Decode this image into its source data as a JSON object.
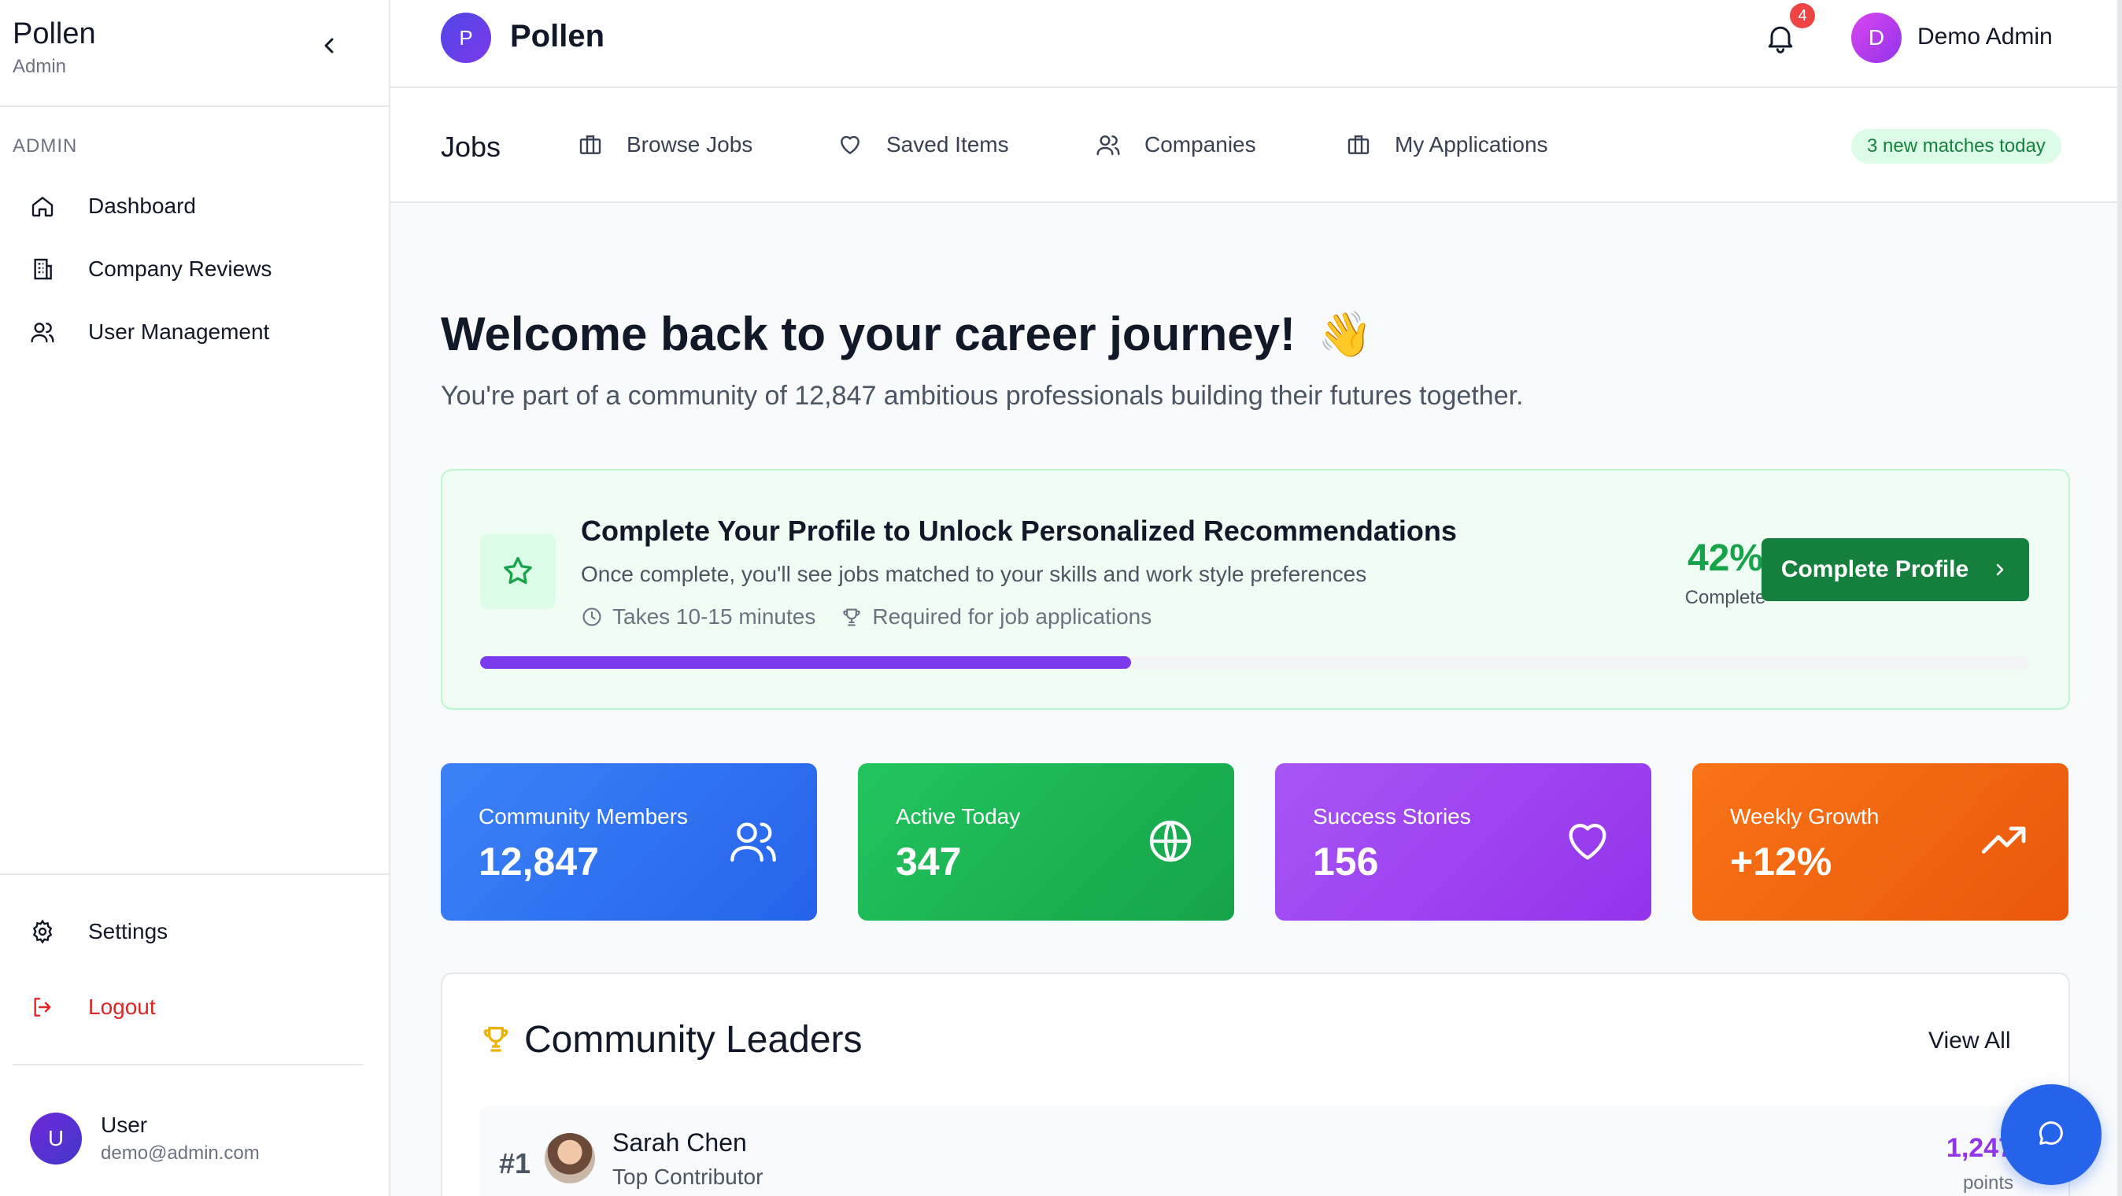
{
  "sidebar": {
    "brand": "Pollen",
    "role": "Admin",
    "section": "ADMIN",
    "items": [
      {
        "label": "Dashboard",
        "icon": "home-icon"
      },
      {
        "label": "Company Reviews",
        "icon": "building-icon"
      },
      {
        "label": "User Management",
        "icon": "users-icon"
      }
    ],
    "settings_label": "Settings",
    "logout_label": "Logout",
    "user": {
      "initial": "U",
      "name": "User",
      "email": "demo@admin.com"
    }
  },
  "header": {
    "logo_initial": "P",
    "logo_text": "Pollen",
    "notification_count": "4",
    "admin_initial": "D",
    "admin_name": "Demo Admin"
  },
  "jobs_nav": {
    "title": "Jobs",
    "links": [
      {
        "label": "Browse Jobs",
        "icon": "briefcase-icon"
      },
      {
        "label": "Saved Items",
        "icon": "heart-icon"
      },
      {
        "label": "Companies",
        "icon": "users-icon"
      },
      {
        "label": "My Applications",
        "icon": "briefcase-icon"
      }
    ],
    "badge": "3 new matches today"
  },
  "welcome": {
    "title": "Welcome back to your career journey!",
    "emoji": "👋",
    "subtitle": "You're part of a community of 12,847 ambitious professionals building their futures together."
  },
  "profile": {
    "title": "Complete Your Profile to Unlock Personalized Recommendations",
    "subtitle": "Once complete, you'll see jobs matched to your skills and work style preferences",
    "time": "Takes 10-15 minutes",
    "required": "Required for job applications",
    "percent_label": "42%",
    "percent_value": 42,
    "complete_label": "Complete",
    "button": "Complete Profile"
  },
  "stats": [
    {
      "label": "Community Members",
      "value": "12,847",
      "icon": "users-icon"
    },
    {
      "label": "Active Today",
      "value": "347",
      "icon": "globe-icon"
    },
    {
      "label": "Success Stories",
      "value": "156",
      "icon": "heart-icon"
    },
    {
      "label": "Weekly Growth",
      "value": "+12%",
      "icon": "trending-up-icon"
    }
  ],
  "leaders": {
    "title": "Community Leaders",
    "view_all": "View All",
    "entries": [
      {
        "rank": "#1",
        "name": "Sarah Chen",
        "role": "Top Contributor",
        "points": "1,247",
        "points_label": "points"
      }
    ]
  },
  "colors": {
    "accent_green": "#15803d",
    "progress_purple": "#7c3aed",
    "blue": "#2563eb",
    "green": "#16a34a",
    "purple": "#9333ea",
    "orange": "#ea580c",
    "logout_red": "#dc2626"
  }
}
